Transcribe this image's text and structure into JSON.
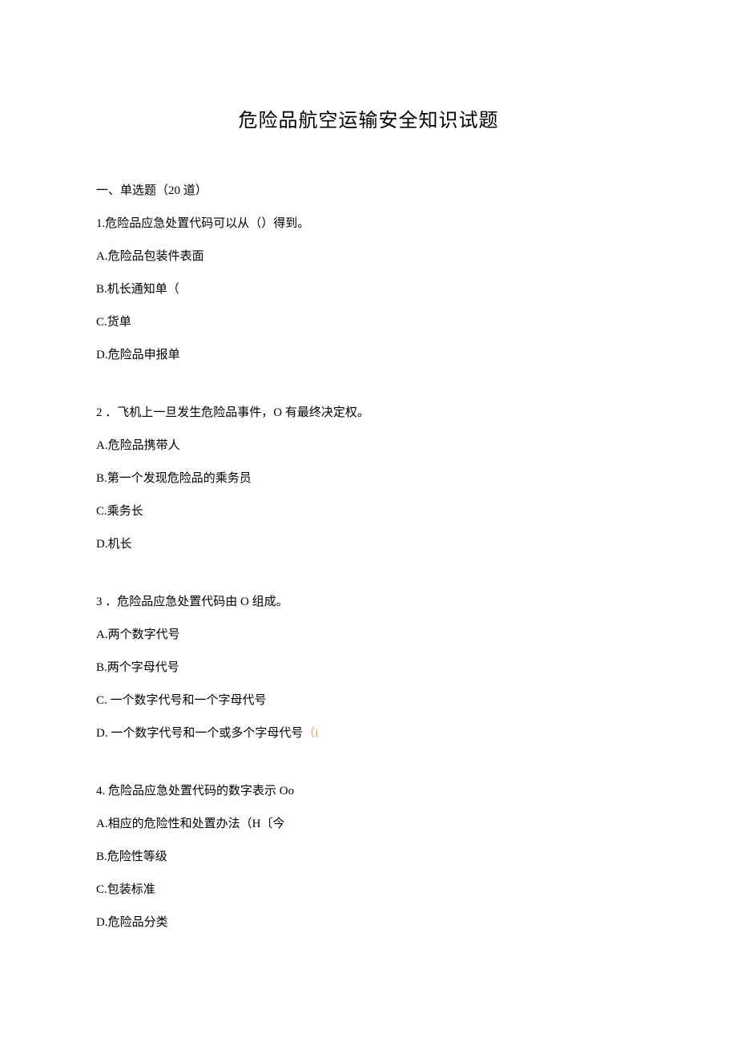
{
  "title": "危险品航空运输安全知识试题",
  "sectionHeader": "一、单选题（20 道）",
  "questions": [
    {
      "text": "1.危险品应急处置代码可以从（）得到。",
      "options": [
        "A.危险品包装件表面",
        "B.机长通知单（",
        "C.货单",
        "D.危险品申报单"
      ]
    },
    {
      "text": "2 ．飞机上一旦发生危险品事件，O 有最终决定权。",
      "options": [
        "A.危险品携带人",
        "B.第一个发现危险品的乘务员",
        "C.乘务长",
        "D.机长"
      ]
    },
    {
      "text": "3 ．危险品应急处置代码由 O 组成。",
      "options": [
        "A.两个数字代号",
        "B.两个字母代号",
        "C.   一个数字代号和一个字母代号"
      ],
      "optionD_pre": "D.   一个数字代号和一个或多个字母代号",
      "optionD_colored": "（i"
    },
    {
      "text": "4. 危险品应急处置代码的数字表示 Oo",
      "options": [
        "A.相应的危险性和处置办法（H〔今",
        "B.危险性等级",
        "C.包装标准",
        "D.危险品分类"
      ]
    }
  ]
}
